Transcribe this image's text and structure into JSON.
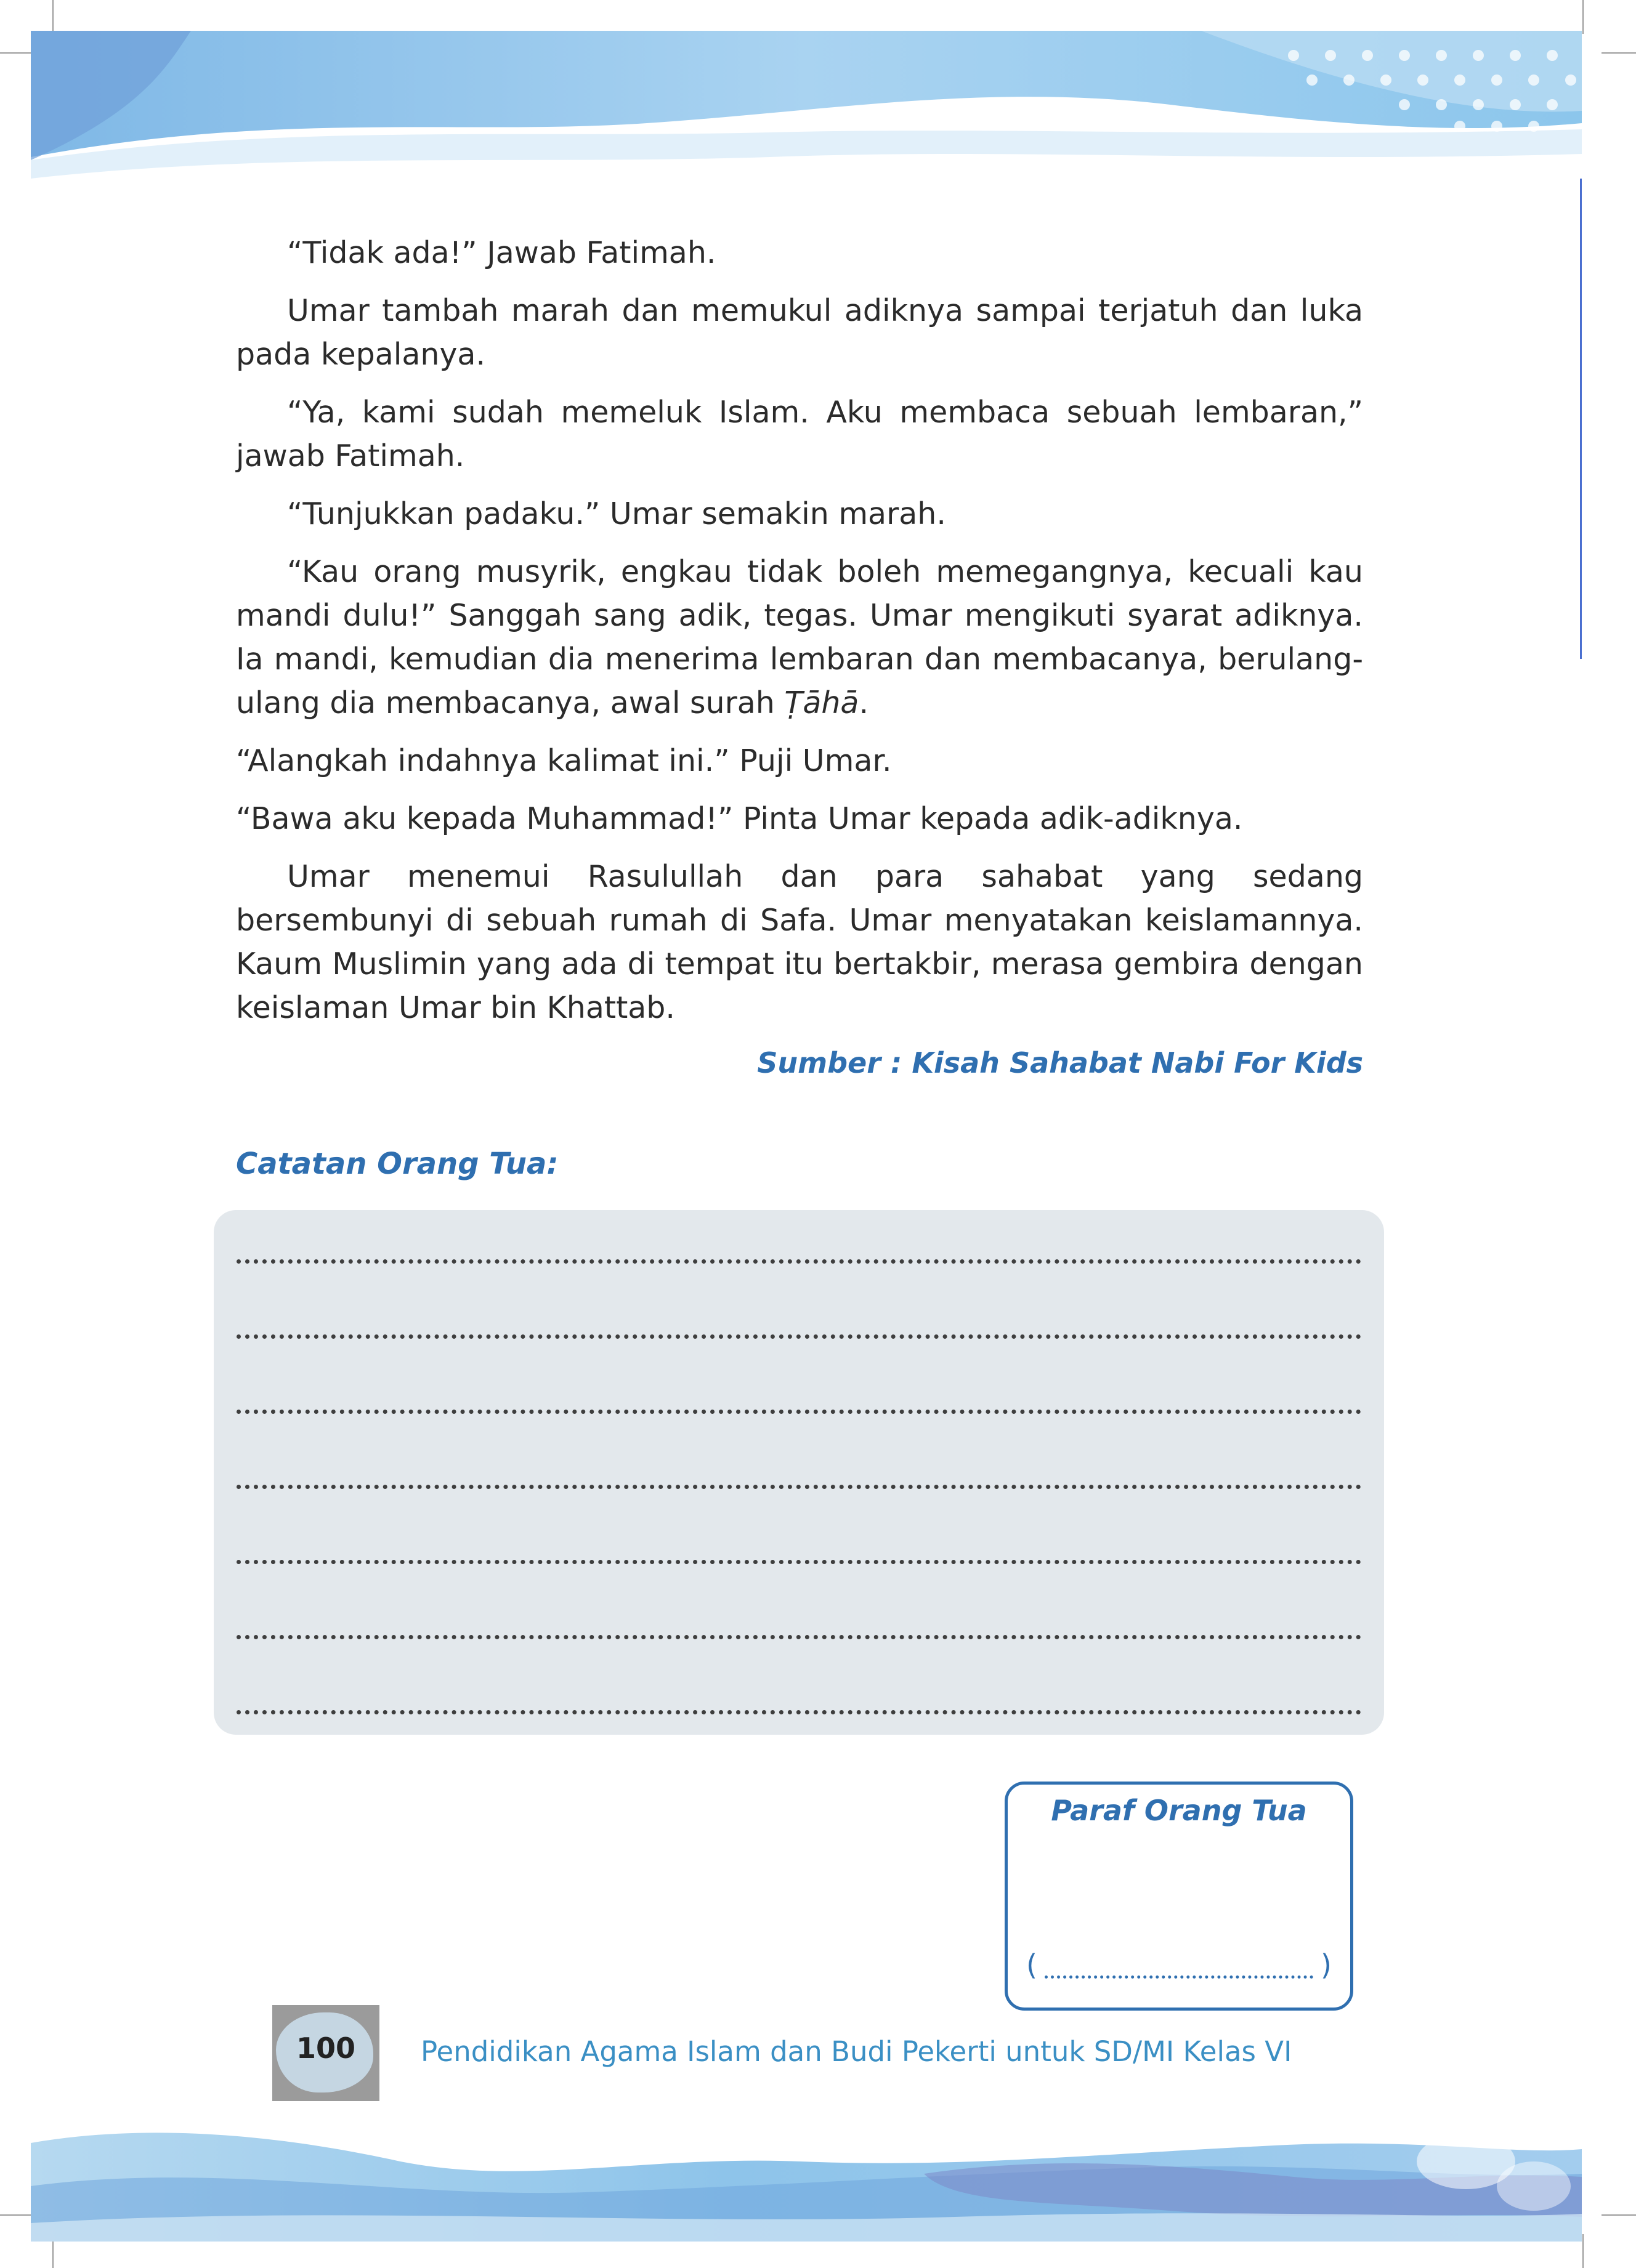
{
  "story": {
    "paragraphs": [
      "“Tidak ada!” Jawab Fatimah.",
      "Umar tambah marah dan memukul adiknya sampai terjatuh dan luka pada kepalanya.",
      "“Ya, kami sudah memeluk Islam. Aku membaca sebuah lembaran,” jawab Fatimah.",
      "“Tunjukkan padaku.” Umar semakin marah.",
      "“Kau orang musyrik, engkau tidak boleh memegangnya, kecuali kau mandi dulu!” Sanggah sang adik, tegas. Umar mengikuti syarat adiknya. Ia mandi, kemudian dia menerima lembaran dan membacanya, berulang-ulang dia membacanya, awal surah",
      "Ṭāhā",
      "“Alangkah indahnya kalimat ini.” Puji Umar.",
      "“Bawa aku kepada Muhammad!” Pinta Umar kepada adik-adiknya.",
      "Umar menemui Rasulullah dan para sahabat yang sedang bersembunyi di sebuah rumah di Safa. Umar menyatakan keislamannya. Kaum Muslimin yang ada di tempat itu bertakbir, merasa gembira dengan keislaman Umar bin Khattab."
    ],
    "source": "Sumber : Kisah Sahabat Nabi For Kids"
  },
  "notes": {
    "heading": "Catatan Orang Tua:"
  },
  "signature": {
    "title": "Paraf Orang Tua",
    "open_paren": "(",
    "close_paren": ")"
  },
  "footer": {
    "page_number": "100",
    "book_title": "Pendidikan Agama Islam dan Budi Pekerti untuk SD/MI Kelas VI"
  },
  "colors": {
    "accent_blue": "#2f6fb0",
    "footer_blue": "#3a8fc4",
    "notes_box": "#e3e8ec"
  }
}
